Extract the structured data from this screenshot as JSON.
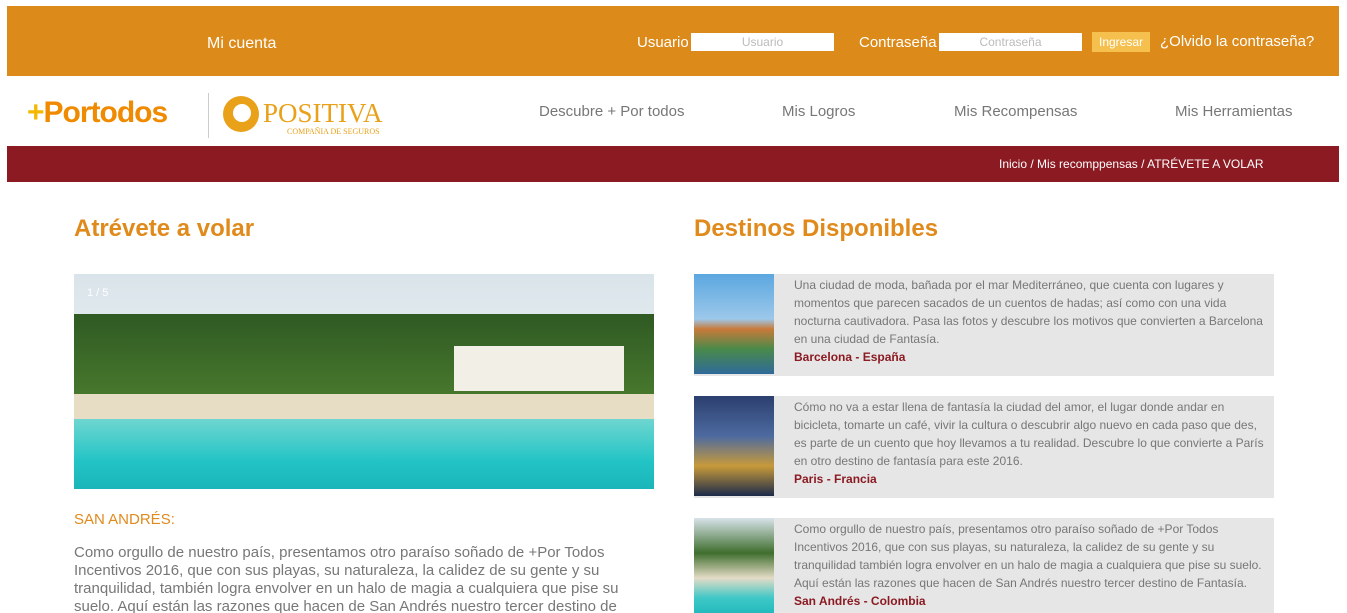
{
  "topbar": {
    "account_label": "Mi cuenta",
    "user_label": "Usuario",
    "user_placeholder": "Usuario",
    "password_label": "Contraseña",
    "password_placeholder": "Contraseña",
    "login_button": "Ingresar",
    "forgot_link": "¿Olvido la contraseña?"
  },
  "header": {
    "logo_primary": "Portodos",
    "logo_plus": "+",
    "logo_secondary": "POSITIVA",
    "logo_secondary_sub": "COMPAÑIA DE SEGUROS",
    "nav": [
      {
        "label": "Descubre + Por todos"
      },
      {
        "label": "Mis Logros"
      },
      {
        "label": "Mis Recompensas"
      },
      {
        "label": "Mis Herramientas"
      }
    ]
  },
  "breadcrumb": {
    "items": [
      "Inicio",
      "Mis recomppensas",
      "ATRÉVETE A VOLAR"
    ],
    "separator": " / "
  },
  "main": {
    "title": "Atrévete a volar",
    "slider_counter": "1 / 5",
    "subtitle": "SAN ANDRÉS:",
    "body": "Como orgullo de nuestro país, presentamos otro paraíso soñado de +Por Todos Incentivos 2016, que con sus playas, su naturaleza, la calidez de su gente y su tranquilidad, también logra envolver en un halo de magia a cualquiera que pise su suelo. Aquí están las razones que hacen de San Andrés nuestro tercer destino de Fantasía"
  },
  "destinations": {
    "title": "Destinos Disponibles",
    "items": [
      {
        "text": "Una ciudad de moda, bañada por el mar Mediterráneo, que cuenta con lugares y momentos que parecen sacados de un cuentos de hadas; así como con una vida nocturna cautivadora. Pasa las fotos y descubre los motivos que convierten a Barcelona en una ciudad de Fantasía.",
        "link": "Barcelona - España"
      },
      {
        "text": "Cómo no va a estar llena de fantasía la ciudad del amor, el lugar donde andar en bicicleta, tomarte un café, vivir la cultura o descubrir algo nuevo en cada paso que des, es parte de un cuento que hoy llevamos a tu realidad. Descubre lo que convierte a París en otro destino de fantasía para este 2016.",
        "link": "Paris - Francia"
      },
      {
        "text": "Como orgullo de nuestro país, presentamos otro paraíso soñado de +Por Todos Incentivos 2016, que con sus playas, su naturaleza, la calidez de su gente y su tranquilidad también logra envolver en un halo de magia a cualquiera que pise su suelo. Aquí están las razones que hacen de San Andrés nuestro tercer destino de Fantasía.",
        "link": "San Andrés - Colombia"
      }
    ]
  },
  "colors": {
    "topbar": "#dc8a1a",
    "crumbbar": "#8b1a22",
    "accent_orange": "#e08a1c",
    "link_red": "#8b1a22"
  }
}
